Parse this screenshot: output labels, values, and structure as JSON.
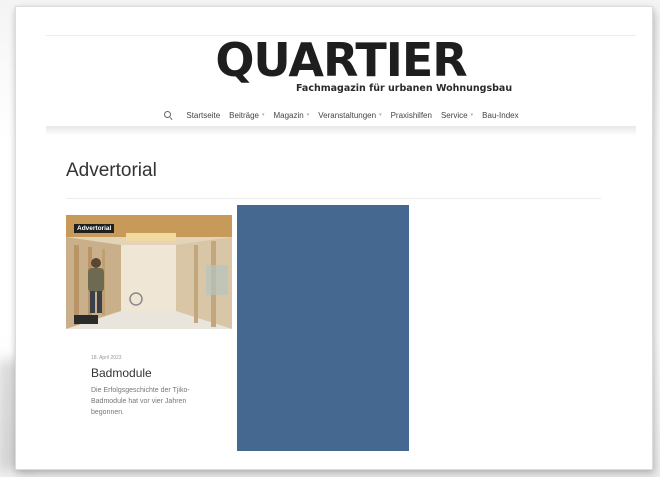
{
  "logo": {
    "wordmark": "QUARTIER",
    "tagline": "Fachmagazin für urbanen Wohnungsbau"
  },
  "nav": {
    "search_icon": "search-icon",
    "items": [
      {
        "label": "Startseite",
        "has_dropdown": false
      },
      {
        "label": "Beiträge",
        "has_dropdown": true
      },
      {
        "label": "Magazin",
        "has_dropdown": true
      },
      {
        "label": "Veranstaltungen",
        "has_dropdown": true
      },
      {
        "label": "Praxishilfen",
        "has_dropdown": false
      },
      {
        "label": "Service",
        "has_dropdown": true
      },
      {
        "label": "Bau-Index",
        "has_dropdown": false
      }
    ],
    "caret": "▾"
  },
  "page": {
    "title": "Advertorial"
  },
  "card": {
    "badge": "Advertorial",
    "date": "18. April 2023",
    "title": "Badmodule",
    "excerpt": "Die Erfolgsgeschichte der Tjiko-Badmodule hat vor vier Jahren begonnen."
  },
  "colors": {
    "ad_block": "#456891",
    "text_dark": "#1e1e1e"
  }
}
